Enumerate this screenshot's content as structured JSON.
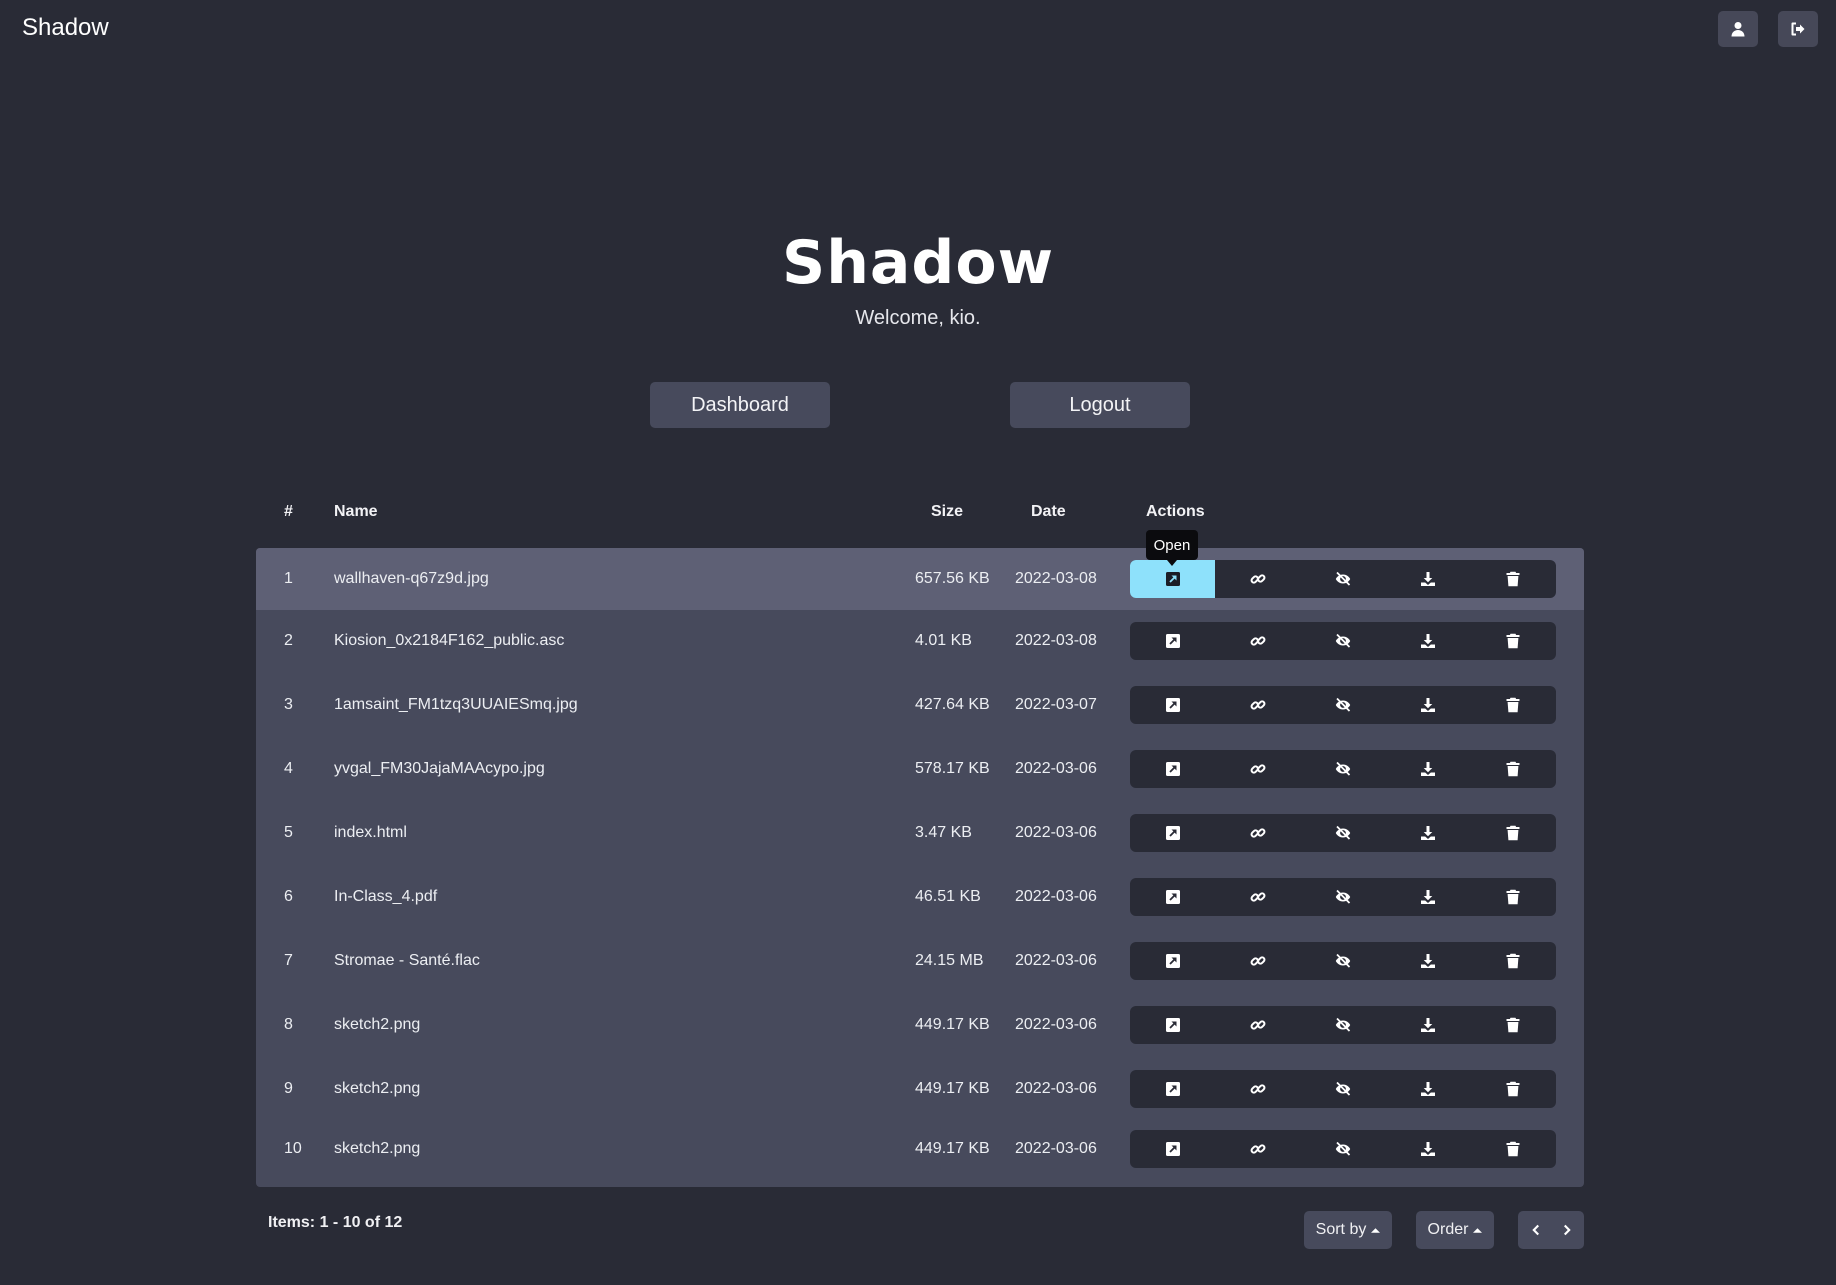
{
  "app": {
    "brand": "Shadow"
  },
  "hero": {
    "title": "Shadow",
    "subtitle": "Welcome, kio."
  },
  "nav": {
    "dashboard_label": "Dashboard",
    "logout_label": "Logout"
  },
  "table": {
    "headers": {
      "num": "#",
      "name": "Name",
      "size": "Size",
      "date": "Date",
      "actions": "Actions"
    },
    "tooltip": "Open",
    "action_icons": [
      "open-external-icon",
      "link-icon",
      "eye-slash-icon",
      "download-icon",
      "trash-icon"
    ],
    "rows": [
      {
        "num": "1",
        "name": "wallhaven-q67z9d.jpg",
        "size": "657.56 KB",
        "date": "2022-03-08"
      },
      {
        "num": "2",
        "name": "Kiosion_0x2184F162_public.asc",
        "size": "4.01 KB",
        "date": "2022-03-08"
      },
      {
        "num": "3",
        "name": "1amsaint_FM1tzq3UUAIESmq.jpg",
        "size": "427.64 KB",
        "date": "2022-03-07"
      },
      {
        "num": "4",
        "name": "yvgal_FM30JajaMAAcypo.jpg",
        "size": "578.17 KB",
        "date": "2022-03-06"
      },
      {
        "num": "5",
        "name": "index.html",
        "size": "3.47 KB",
        "date": "2022-03-06"
      },
      {
        "num": "6",
        "name": "In-Class_4.pdf",
        "size": "46.51 KB",
        "date": "2022-03-06"
      },
      {
        "num": "7",
        "name": "Stromae - Santé.flac",
        "size": "24.15 MB",
        "date": "2022-03-06"
      },
      {
        "num": "8",
        "name": "sketch2.png",
        "size": "449.17 KB",
        "date": "2022-03-06"
      },
      {
        "num": "9",
        "name": "sketch2.png",
        "size": "449.17 KB",
        "date": "2022-03-06"
      },
      {
        "num": "10",
        "name": "sketch2.png",
        "size": "449.17 KB",
        "date": "2022-03-06"
      }
    ]
  },
  "footer": {
    "items_info": "Items: 1 - 10 of 12",
    "sort_label": "Sort by",
    "order_label": "Order"
  },
  "colors": {
    "background": "#292b36",
    "panel": "#474a5c",
    "active_row": "#5e6075",
    "accent": "#8ee1fb"
  }
}
